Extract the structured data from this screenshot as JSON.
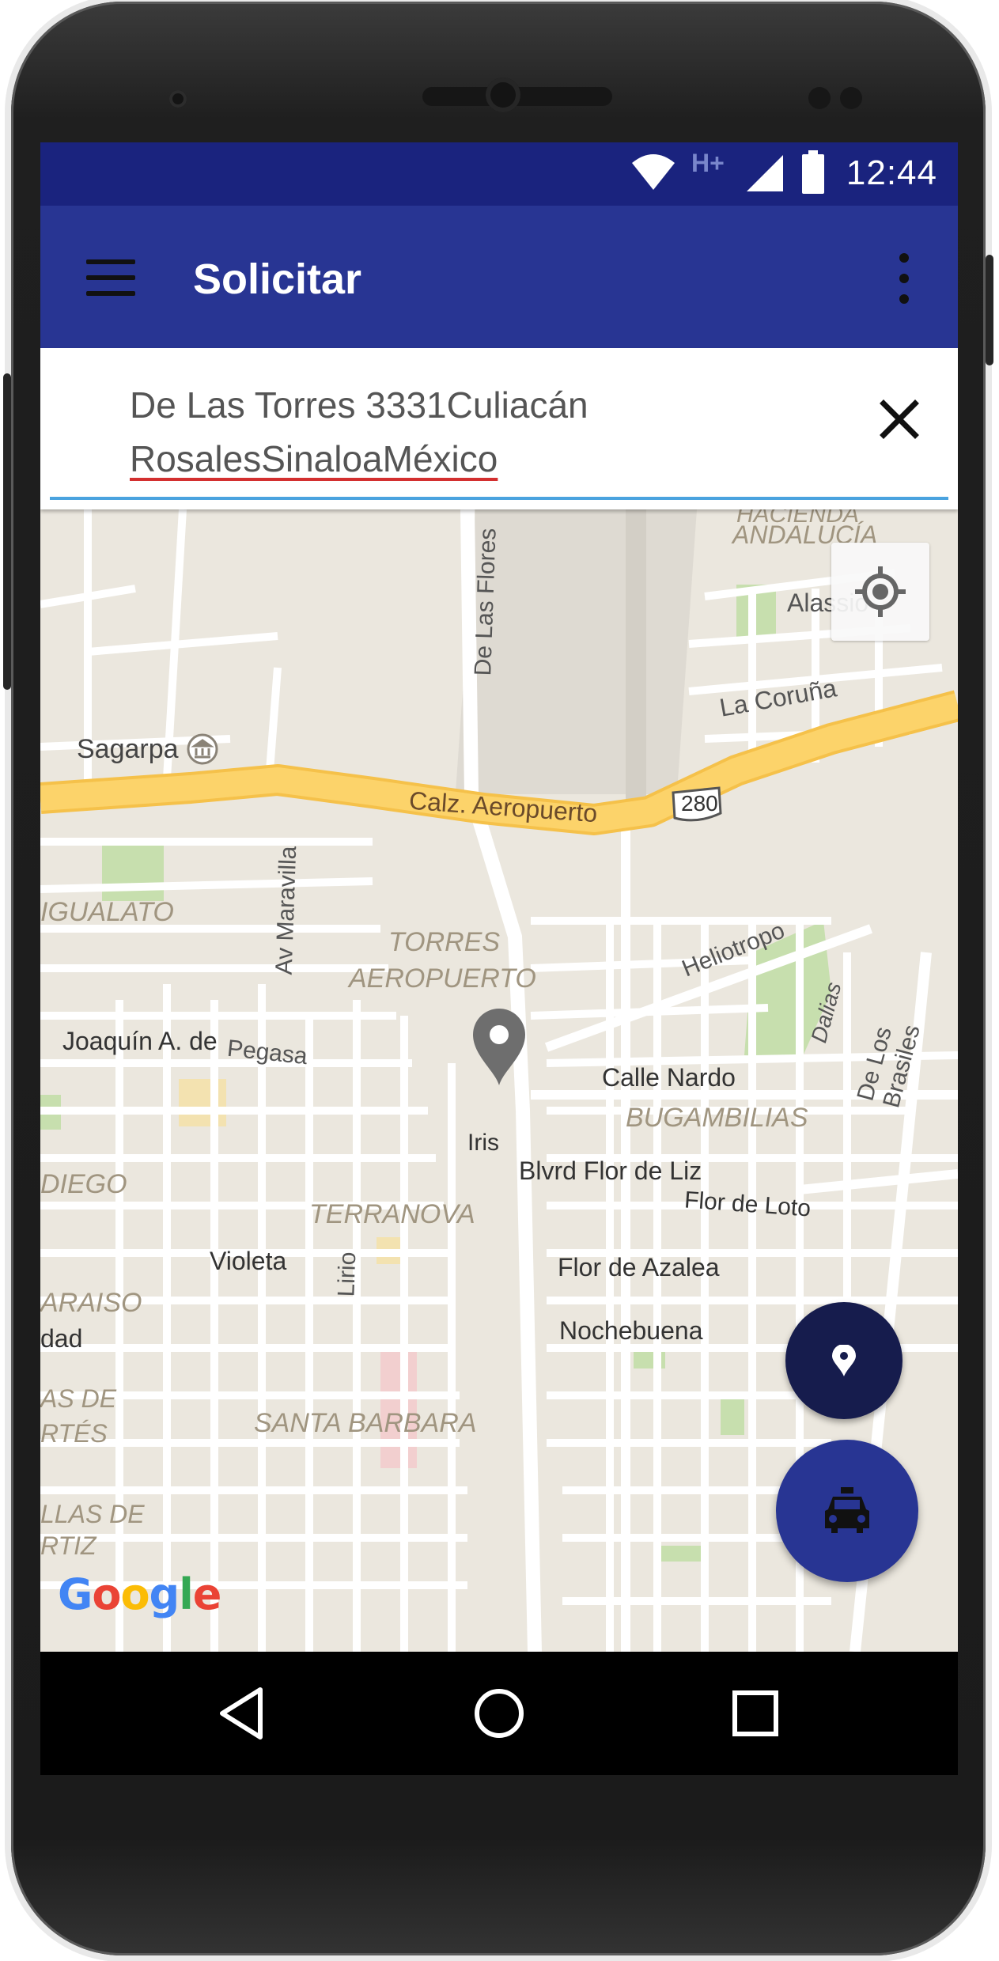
{
  "status_bar": {
    "time": "12:44",
    "network": "H+",
    "icons": [
      "wifi-icon",
      "network-type-icon",
      "signal-icon",
      "battery-icon"
    ]
  },
  "app_bar": {
    "title": "Solicitar",
    "menu_icon": "hamburger-menu-icon",
    "overflow_icon": "more-vert-icon"
  },
  "search": {
    "address_line1": "De Las Torres 3331Culiacán",
    "address_line2": "RosalesSinaloaMéxico",
    "clear_icon": "close-icon"
  },
  "map": {
    "attribution": "Google",
    "locate_icon": "my-location-icon",
    "marker_icon": "map-pin-icon",
    "labels": {
      "hacienda": "HACIENDA",
      "andalucia": "ANDALUCÍA",
      "alassio": "Alassio",
      "la_coruna": "La Coruña",
      "de_las_flores": "De Las Flores",
      "sagarpa": "Sagarpa",
      "calz_aeropuerto": "Calz. Aeropuerto",
      "route_280": "280",
      "igualato": "IGUALATO",
      "av_maravilla": "Av Maravilla",
      "torres": "TORRES",
      "aeropuerto": "AEROPUERTO",
      "heliotropo": "Heliotropo",
      "dalias": "Dalias",
      "de_los_brasiles": "De Los Brasiles",
      "joaquin": "Joaquín A. de",
      "pegasa": "Pegasa",
      "calle_nardo": "Calle Nardo",
      "bugambilias": "BUGAMBILIAS",
      "iris": "Iris",
      "blvd_flor_de_liz": "Blvrd Flor de Liz",
      "diego": "DIEGO",
      "terranova": "TERRANOVA",
      "flor_de_loto": "Flor de Loto",
      "violeta": "Violeta",
      "lirio": "Lirio",
      "flor_de_azalea": "Flor de Azalea",
      "araiso": "ARAISO",
      "nochebuena": "Nochebuena",
      "dad": "dad",
      "as_de": "AS DE",
      "rtes": "RTÉS",
      "santa_barbara": "SANTA BARBARA",
      "las_de": "LLAS DE",
      "rtiz": "RTIZ"
    },
    "colors": {
      "land": "#ebe7de",
      "road": "#ffffff",
      "highway": "#fcd36a",
      "park": "#c7dfae",
      "label": "#a09580"
    }
  },
  "fabs": {
    "location_icon": "location-pin-icon",
    "taxi_icon": "taxi-icon"
  },
  "nav_bar": {
    "back_icon": "back-triangle-icon",
    "home_icon": "home-circle-icon",
    "recents_icon": "recents-square-icon"
  },
  "colors": {
    "primary": "#283593",
    "primary_dark": "#1a237e",
    "fab_dark": "#161c4d",
    "accent_underline": "#4aa3df"
  }
}
